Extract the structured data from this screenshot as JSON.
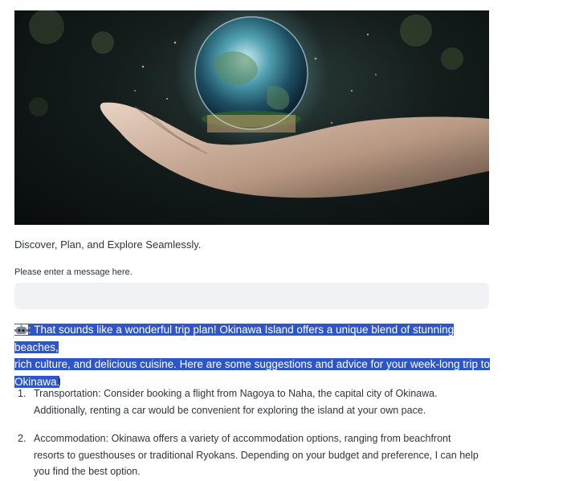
{
  "tagline": "Discover, Plan, and Explore Seamlessly.",
  "input": {
    "label": "Please enter a message here.",
    "value": "",
    "placeholder": ""
  },
  "response": {
    "lines": [
      ": That sounds like a wonderful trip plan! Okinawa Island offers a unique blend of stunning beaches,",
      "rich culture, and delicious cuisine. Here are some suggestions and advice for your week-long trip to",
      "Okinawa."
    ],
    "selection_color": "#2f56c9"
  },
  "suggestions": [
    {
      "number": "1.",
      "lines": [
        "Transportation: Consider booking a flight from Nagoya to Naha, the capital city of Okinawa.",
        "Additionally, renting a car would be convenient for exploring the island at your own pace."
      ]
    },
    {
      "number": "2.",
      "lines": [
        "Accommodation: Okinawa offers a variety of accommodation options, ranging from beachfront",
        "resorts to guesthouses or traditional Ryokans. Depending on your budget and preference, I can help",
        "you find the best option."
      ]
    }
  ],
  "icons": {
    "assistant": "robot-icon",
    "cursor": "text-cursor-icon"
  },
  "colors": {
    "text": "#31333f",
    "input_bg": "#f0f2f6"
  }
}
